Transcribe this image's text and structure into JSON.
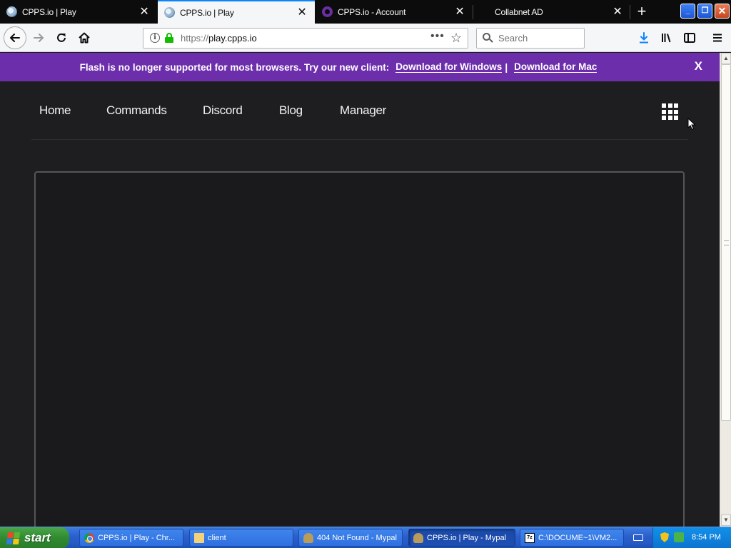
{
  "browser": {
    "tabs": [
      {
        "title": "CPPS.io | Play",
        "favicon": "cpps-favicon"
      },
      {
        "title": "CPPS.io | Play",
        "favicon": "cpps-favicon",
        "active": true
      },
      {
        "title": "CPPS.io - Account",
        "favicon": "account-favicon"
      },
      {
        "title": "Collabnet AD",
        "favicon": "none"
      }
    ],
    "tab_close_glyph": "✕",
    "new_tab_glyph": "+",
    "url": {
      "protocol": "https://",
      "host": "play.cpps.io"
    },
    "search_placeholder": "Search",
    "page_actions_glyph": "•••",
    "window_buttons": {
      "minimize": "_",
      "maximize": "❐",
      "close": "✕"
    }
  },
  "banner": {
    "message": "Flash is no longer supported for most browsers. Try our new client:",
    "windows_link": "Download for Windows",
    "separator": "|",
    "mac_link": "Download for Mac",
    "close": "X",
    "color": "#6d2eac"
  },
  "site_nav": {
    "links": [
      "Home",
      "Commands",
      "Discord",
      "Blog",
      "Manager"
    ]
  },
  "taskbar": {
    "start_label": "start",
    "tasks": [
      {
        "label": "CPPS.io | Play - Chr...",
        "icon": "chrome-icon"
      },
      {
        "label": "client",
        "icon": "folder-icon"
      },
      {
        "label": "404 Not Found - Mypal",
        "icon": "mypal-icon"
      },
      {
        "label": "CPPS.io | Play - Mypal",
        "icon": "mypal-icon",
        "active": true
      },
      {
        "label": "C:\\DOCUME~1\\VM2...",
        "icon": "7zip-icon"
      }
    ],
    "sevenzip_icon_text": "7z",
    "clock": "8:54 PM"
  }
}
